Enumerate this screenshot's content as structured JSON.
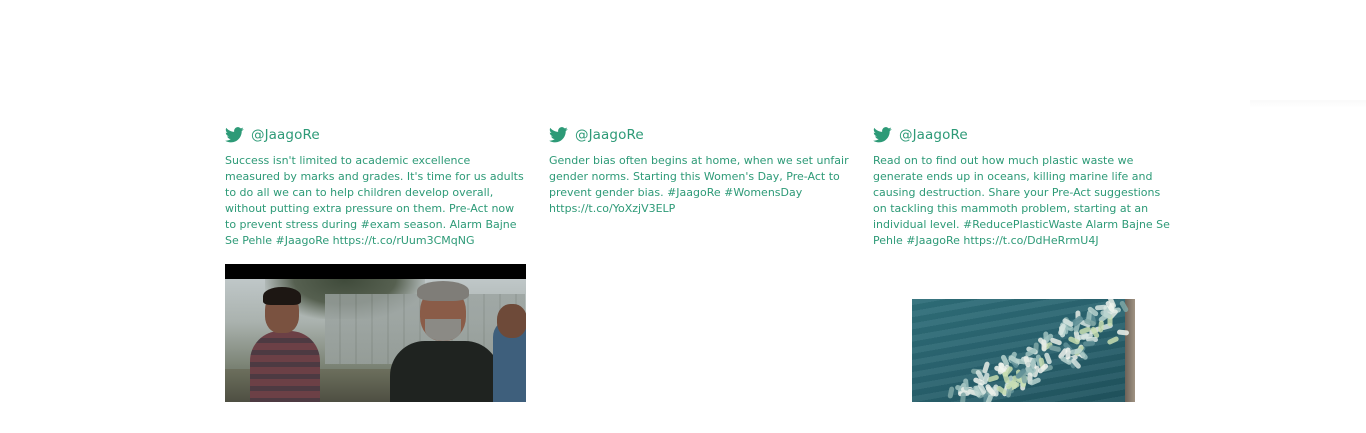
{
  "colors": {
    "accent": "#2d9a77",
    "background": "#ffffff"
  },
  "tweets": [
    {
      "icon": "twitter-bird-icon",
      "handle": "@JaagoRe",
      "text": "Success isn't limited to academic excellence measured by marks and grades. It's time for us adults to do all we can to help children develop overall, without putting extra pressure on them. Pre-Act now to prevent stress during #exam season. Alarm Bajne Se Pehle #JaagoRe https://t.co/rUum3CMqNG",
      "media": "video-still"
    },
    {
      "icon": "twitter-bird-icon",
      "handle": "@JaagoRe",
      "text": "Gender bias often begins at home, when we set unfair gender norms. Starting this Women's Day, Pre-Act to prevent gender bias. #JaagoRe #WomensDay https://t.co/YoXzjV3ELP",
      "media": null
    },
    {
      "icon": "twitter-bird-icon",
      "handle": "@JaagoRe",
      "text": "Read on to find out how much plastic waste we generate ends up in oceans, killing marine life and causing destruction. Share your Pre-Act suggestions on tackling this mammoth problem, starting at an individual level. #ReducePlasticWaste Alarm Bajne Se Pehle #JaagoRe https://t.co/DdHeRrmU4J",
      "media": "plastic-waste-photo"
    }
  ]
}
